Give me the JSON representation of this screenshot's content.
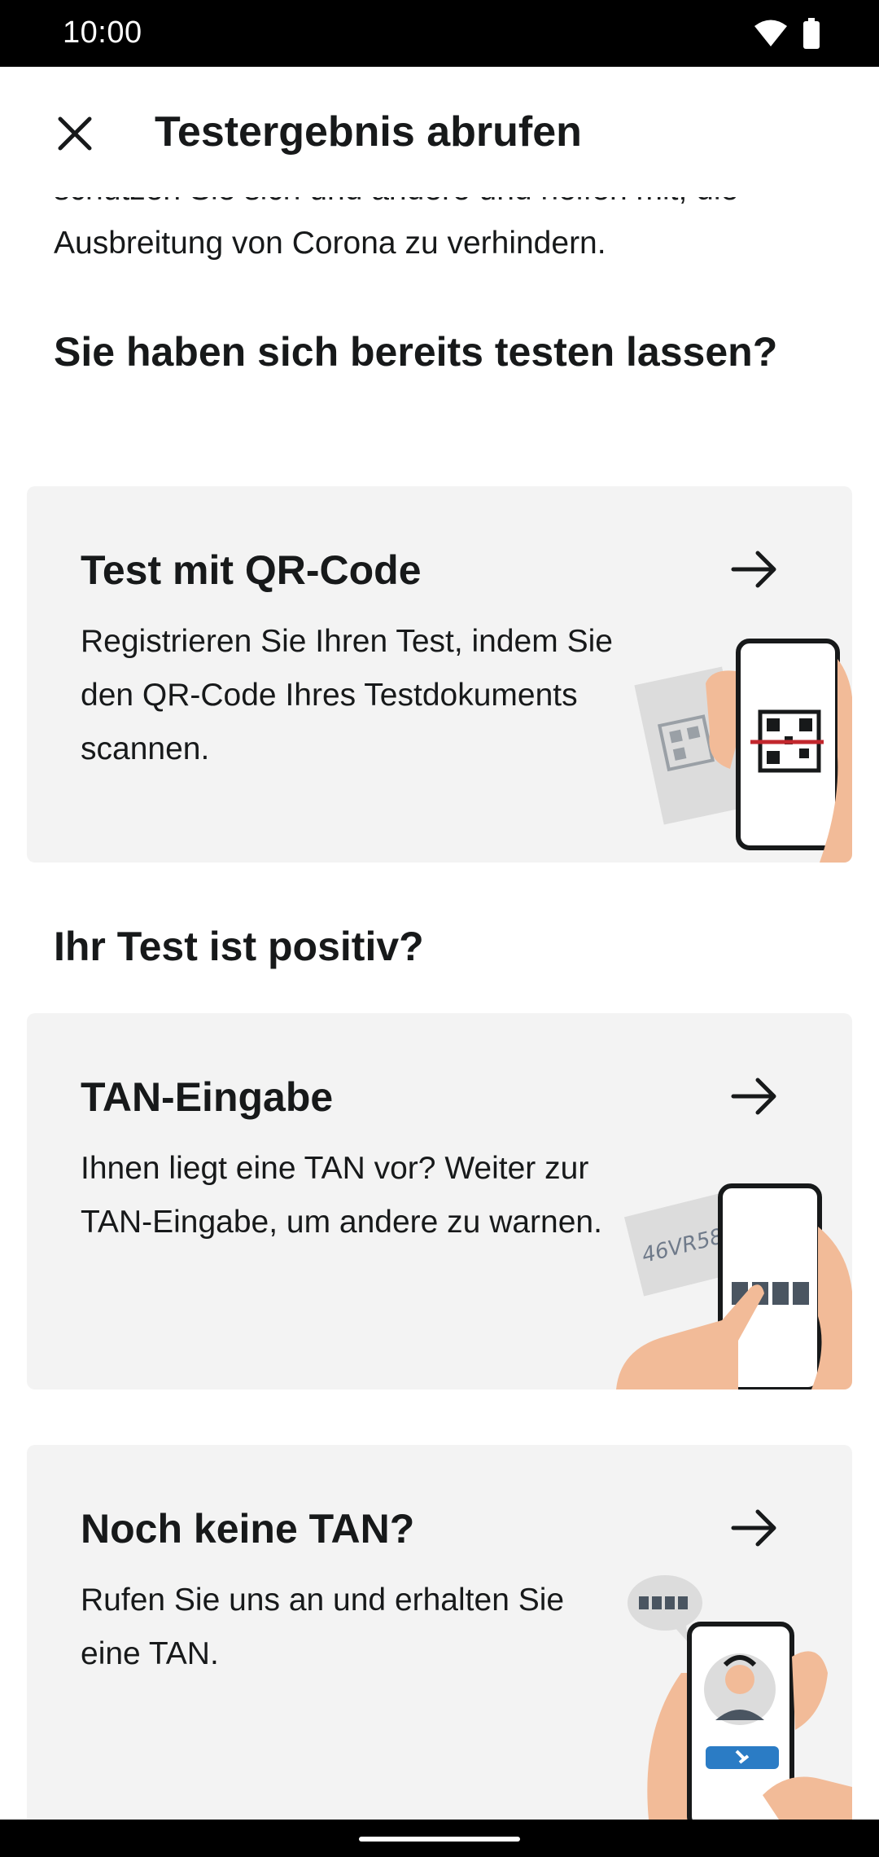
{
  "status_bar": {
    "time": "10:00",
    "icons": [
      "wifi-icon",
      "battery-icon"
    ]
  },
  "app_bar": {
    "title": "Testergebnis abrufen",
    "close_icon": "close-icon"
  },
  "intro": {
    "line1": "schützen Sie sich und andere und helfen mit, die",
    "line2": "Ausbreitung von Corona zu verhindern."
  },
  "section_tested": {
    "heading": "Sie haben sich bereits testen lassen?"
  },
  "card_qr": {
    "title": "Test mit QR-Code",
    "body": "Registrieren Sie Ihren Test, indem Sie den QR-Code Ihres Testdokuments scannen.",
    "arrow_icon": "arrow-right-icon"
  },
  "section_positive": {
    "heading": "Ihr Test ist positiv?"
  },
  "card_tan": {
    "title": "TAN-Eingabe",
    "body": "Ihnen liegt eine TAN vor? Weiter zur TAN-Eingabe, um andere zu warnen.",
    "arrow_icon": "arrow-right-icon",
    "illustration_text": "46VR58"
  },
  "card_no_tan": {
    "title": "Noch keine TAN?",
    "body": "Rufen Sie uns an und erhalten Sie eine TAN.",
    "arrow_icon": "arrow-right-icon"
  },
  "colors": {
    "card_bg": "#f3f3f3",
    "skin": "#f2bb98",
    "scan_line": "#c2272d",
    "call_button": "#2b7cc5"
  }
}
